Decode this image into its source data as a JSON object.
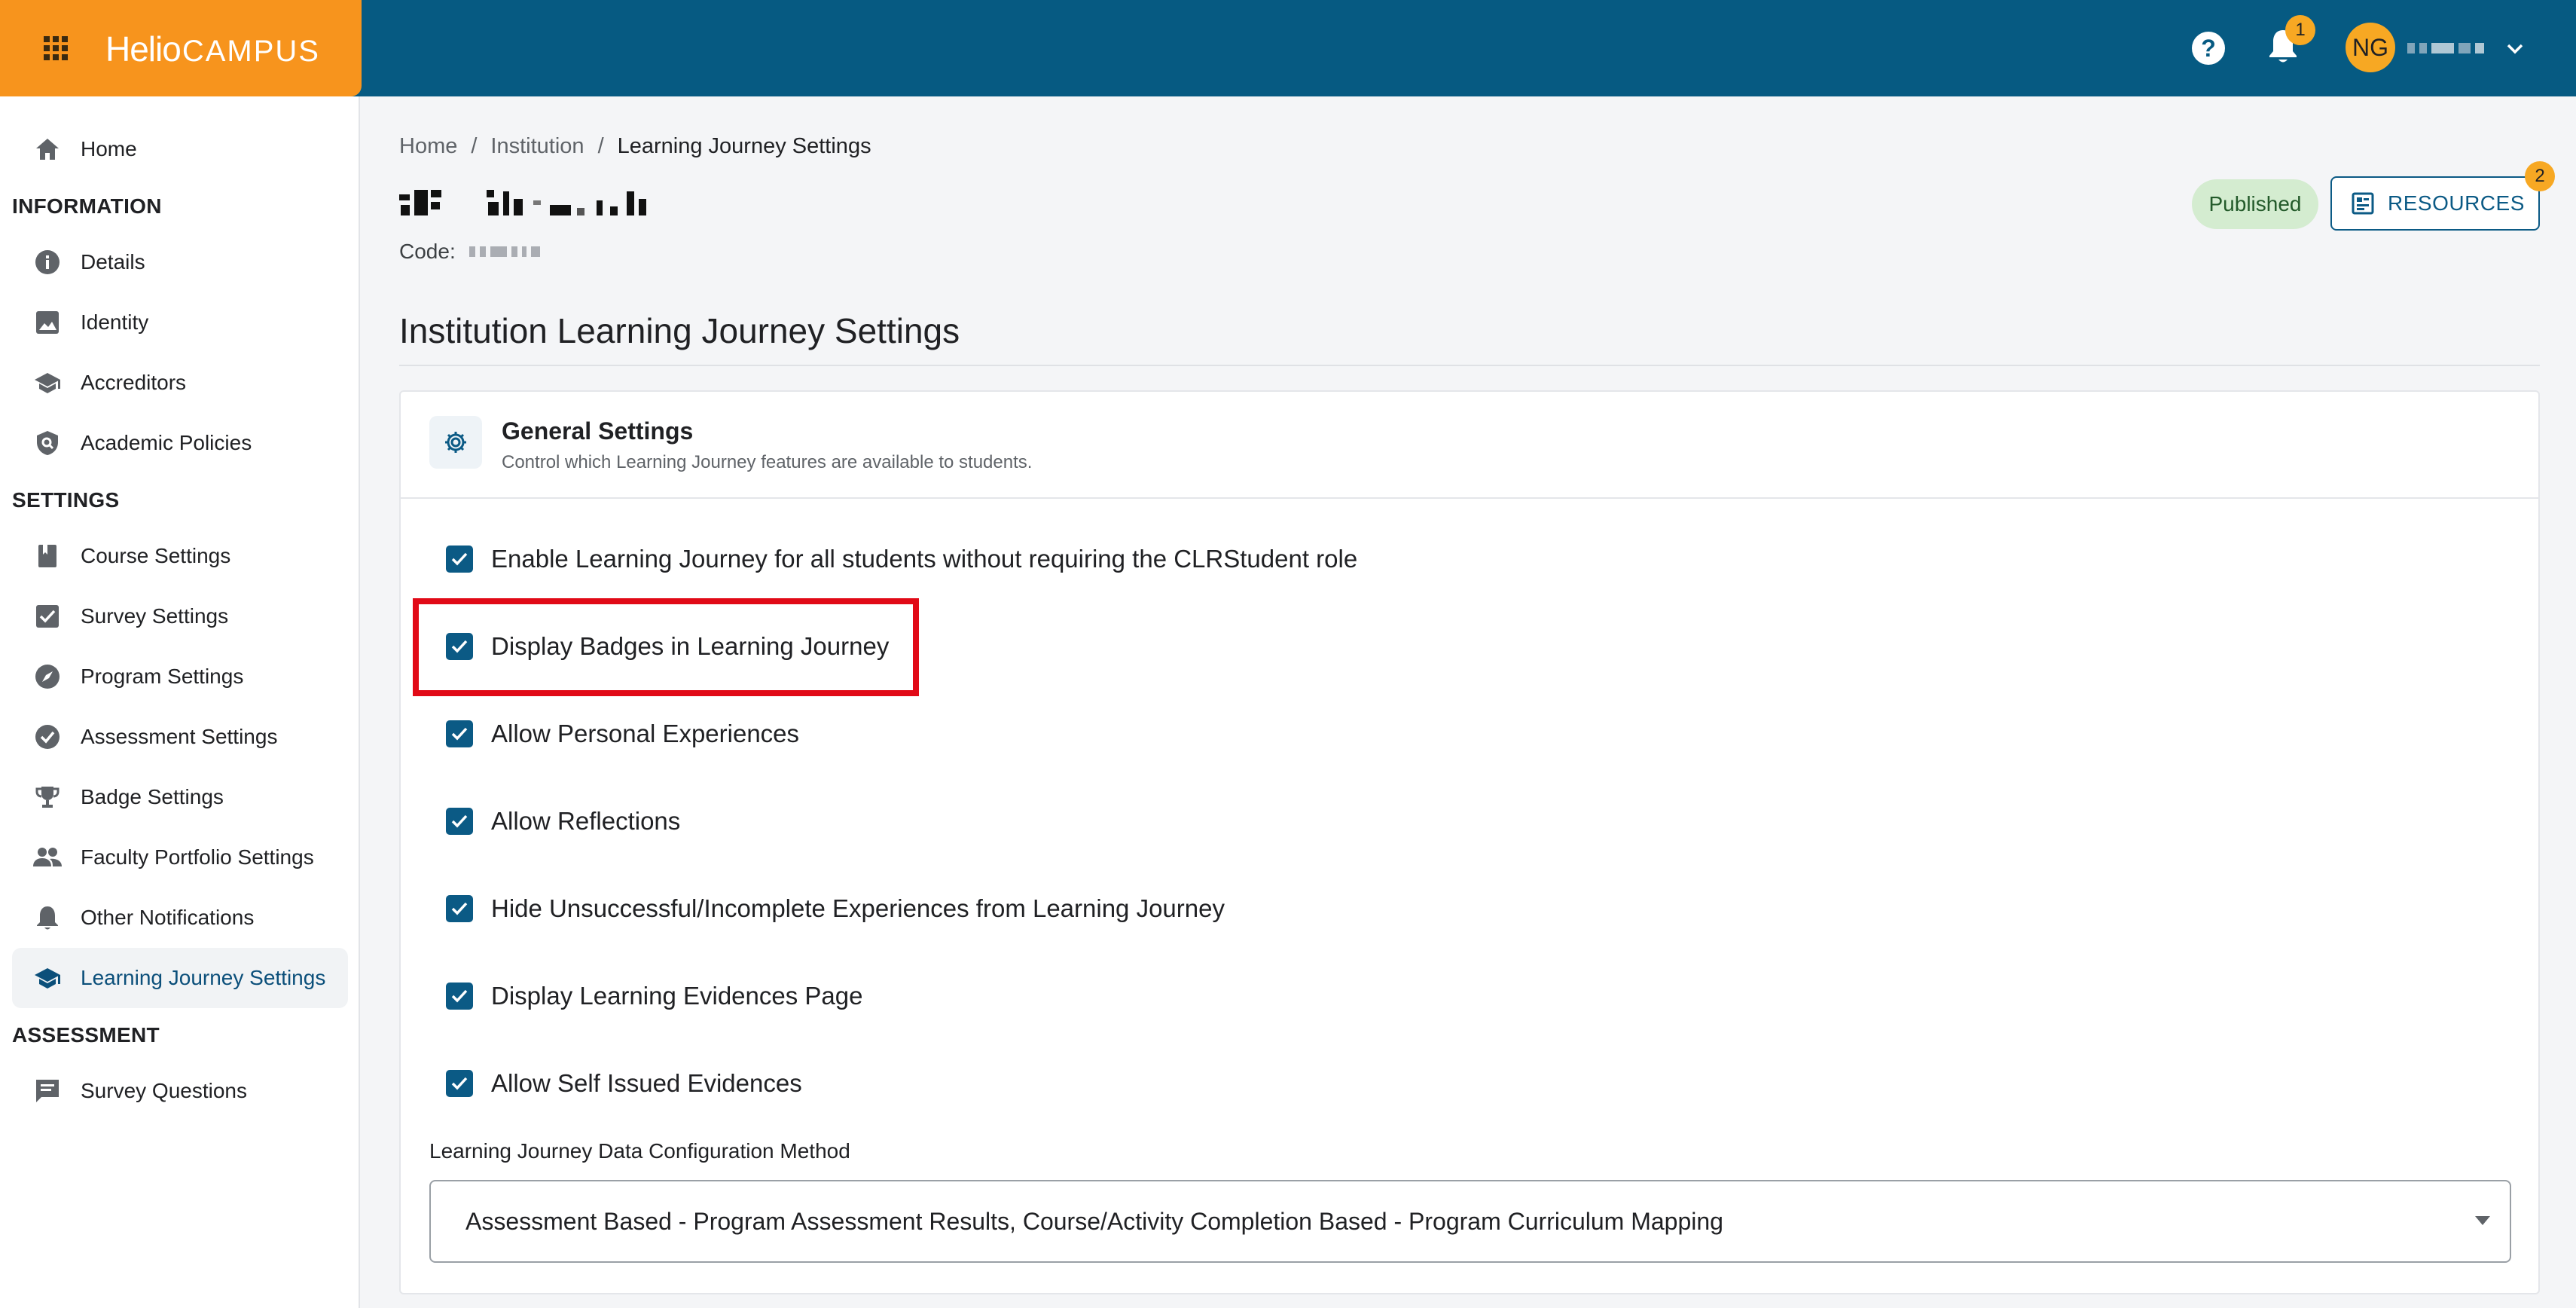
{
  "app": {
    "logo_part1": "Helio",
    "logo_part2": "CAMPUS"
  },
  "topbar": {
    "notifications_count": "1",
    "avatar_initials": "NG"
  },
  "sidebar": {
    "home": "Home",
    "section_information": "INFORMATION",
    "information_items": [
      "Details",
      "Identity",
      "Accreditors",
      "Academic Policies"
    ],
    "section_settings": "SETTINGS",
    "settings_items": [
      "Course Settings",
      "Survey Settings",
      "Program Settings",
      "Assessment Settings",
      "Badge Settings",
      "Faculty Portfolio Settings",
      "Other Notifications",
      "Learning Journey Settings"
    ],
    "section_assessment": "ASSESSMENT",
    "assessment_items": [
      "Survey Questions"
    ]
  },
  "breadcrumb": {
    "home": "Home",
    "sep1": "/",
    "institution": "Institution",
    "sep2": "/",
    "current": "Learning Journey Settings"
  },
  "header": {
    "code_label": "Code:",
    "status_badge": "Published",
    "resources_label": "RESOURCES",
    "resources_count": "2"
  },
  "page_title": "Institution Learning Journey Settings",
  "general_settings": {
    "title": "General Settings",
    "subtitle": "Control which Learning Journey features are available to students.",
    "options": [
      {
        "label": "Enable Learning Journey for all students without requiring the CLRStudent role",
        "checked": true
      },
      {
        "label": "Display Badges in Learning Journey",
        "checked": true
      },
      {
        "label": "Allow Personal Experiences",
        "checked": true
      },
      {
        "label": "Allow Reflections",
        "checked": true
      },
      {
        "label": "Hide Unsuccessful/Incomplete Experiences from Learning Journey",
        "checked": true
      },
      {
        "label": "Display Learning Evidences Page",
        "checked": true
      },
      {
        "label": "Allow Self Issued Evidences",
        "checked": true
      }
    ],
    "data_config_label": "Learning Journey Data Configuration Method",
    "data_config_value": "Assessment Based - Program Assessment Results, Course/Activity Completion Based - Program Curriculum Mapping"
  },
  "colors": {
    "topbar": "#065a82",
    "brand": "#f7941d",
    "accent": "#0b5a85",
    "highlight": "#e10a17",
    "badge": "#f7a823"
  }
}
